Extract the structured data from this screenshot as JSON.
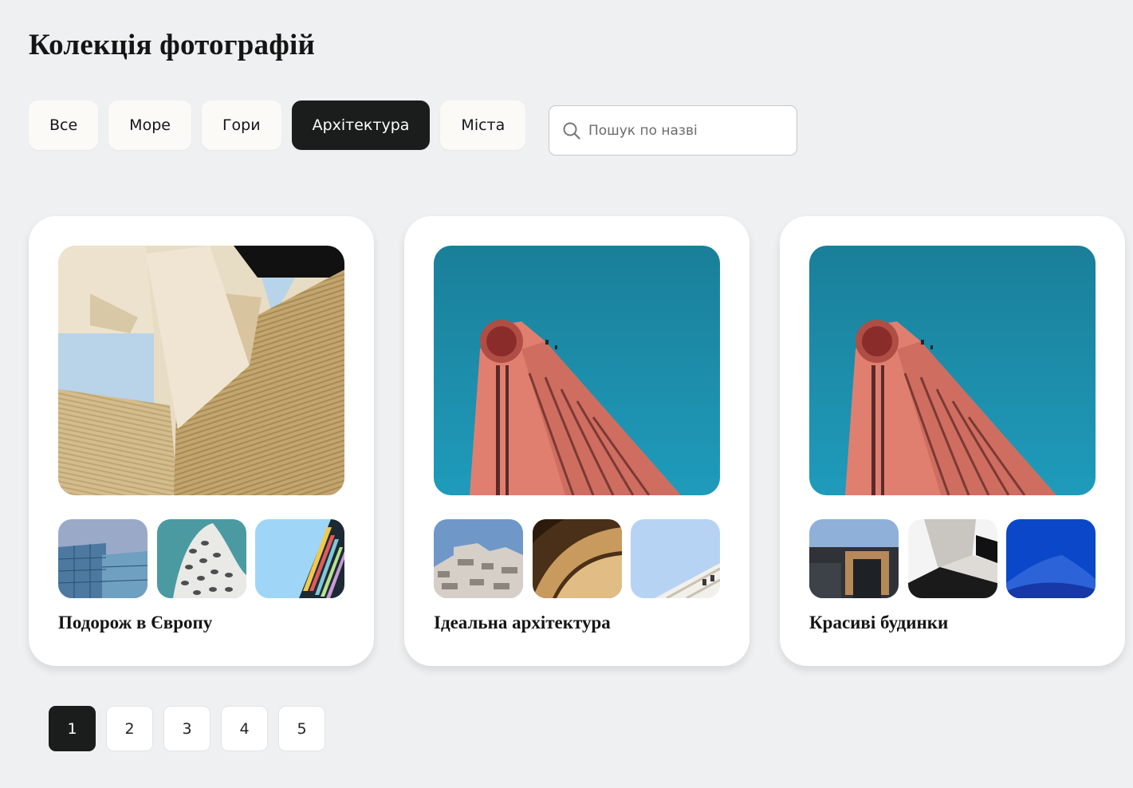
{
  "page": {
    "title": "Колекція фотографій"
  },
  "filters": [
    {
      "label": "Все",
      "active": false
    },
    {
      "label": "Море",
      "active": false
    },
    {
      "label": "Гори",
      "active": false
    },
    {
      "label": "Архітектура",
      "active": true
    },
    {
      "label": "Міста",
      "active": false
    }
  ],
  "search": {
    "placeholder": "Пошук по назві",
    "value": "",
    "icon": "search-icon"
  },
  "cards": [
    {
      "title": "Подорож в Європу",
      "main_image": "beige-stone-facade-with-sky",
      "thumbnails": [
        "glass-office-tower",
        "white-perforated-curved-building",
        "colorful-striped-facade"
      ]
    },
    {
      "title": "Ідеальна архітектура",
      "main_image": "pink-tower-against-teal-sky",
      "thumbnails": [
        "stacked-concrete-blocks-building",
        "vaulted-arch-ceiling",
        "white-balconies-against-sky"
      ]
    },
    {
      "title": "Красиві будинки",
      "main_image": "pink-tower-against-teal-sky",
      "thumbnails": [
        "dark-modern-house-wood-frame",
        "white-angled-building",
        "blue-wave-roof"
      ]
    }
  ],
  "pagination": {
    "pages": [
      "1",
      "2",
      "3",
      "4",
      "5"
    ],
    "current": "1"
  }
}
